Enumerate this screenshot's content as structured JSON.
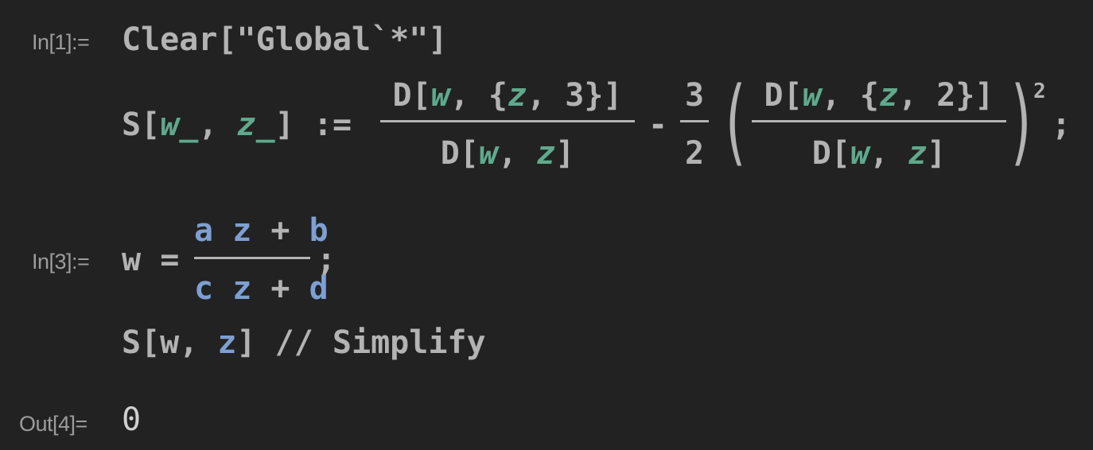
{
  "cells": {
    "in1": {
      "label": "In[1]:=",
      "line1": {
        "prefix": "Clear",
        "bracket_open": "[",
        "string": "\"Global`*\"",
        "bracket_close": "]"
      },
      "line2": {
        "head": "S",
        "lb": "[",
        "arg1": "w_",
        "comma": ",",
        "arg2": "z_",
        "rb": "]",
        "op": ":=",
        "frac1_num": {
          "d": "D[",
          "w": "w",
          "c1": ", {",
          "z": "z",
          "c2": ", 3}]"
        },
        "frac1_den": {
          "d": "D[",
          "w": "w",
          "c1": ", ",
          "z": "z",
          "c2": "]"
        },
        "minus": "-",
        "const_num": "3",
        "const_den": "2",
        "paren_open": "(",
        "frac2_num": {
          "d": "D[",
          "w": "w",
          "c1": ", {",
          "z": "z",
          "c2": ", 2}]"
        },
        "frac2_den": {
          "d": "D[",
          "w": "w",
          "c1": ", ",
          "z": "z",
          "c2": "]"
        },
        "paren_close": ")",
        "exponent": "2",
        "semicolon": ";"
      }
    },
    "in3": {
      "label": "In[3]:=",
      "line1": {
        "lhs": "w",
        "eq": "=",
        "num": {
          "a": "a",
          "z": "z",
          "plus": "+",
          "b": "b"
        },
        "den": {
          "c": "c",
          "z": "z",
          "plus": "+",
          "d": "d"
        },
        "semicolon": ";"
      },
      "line2": {
        "head": "S[w, ",
        "z": "z",
        "tail": "] // Simplify"
      }
    },
    "out4": {
      "label": "Out[4]=",
      "value": "0"
    }
  },
  "colors": {
    "background": "#222222",
    "text": "#b3b3b3",
    "pattern_var": "#5fa98c",
    "global_symbol": "#7d9fd2",
    "label": "#9c9c9c"
  }
}
